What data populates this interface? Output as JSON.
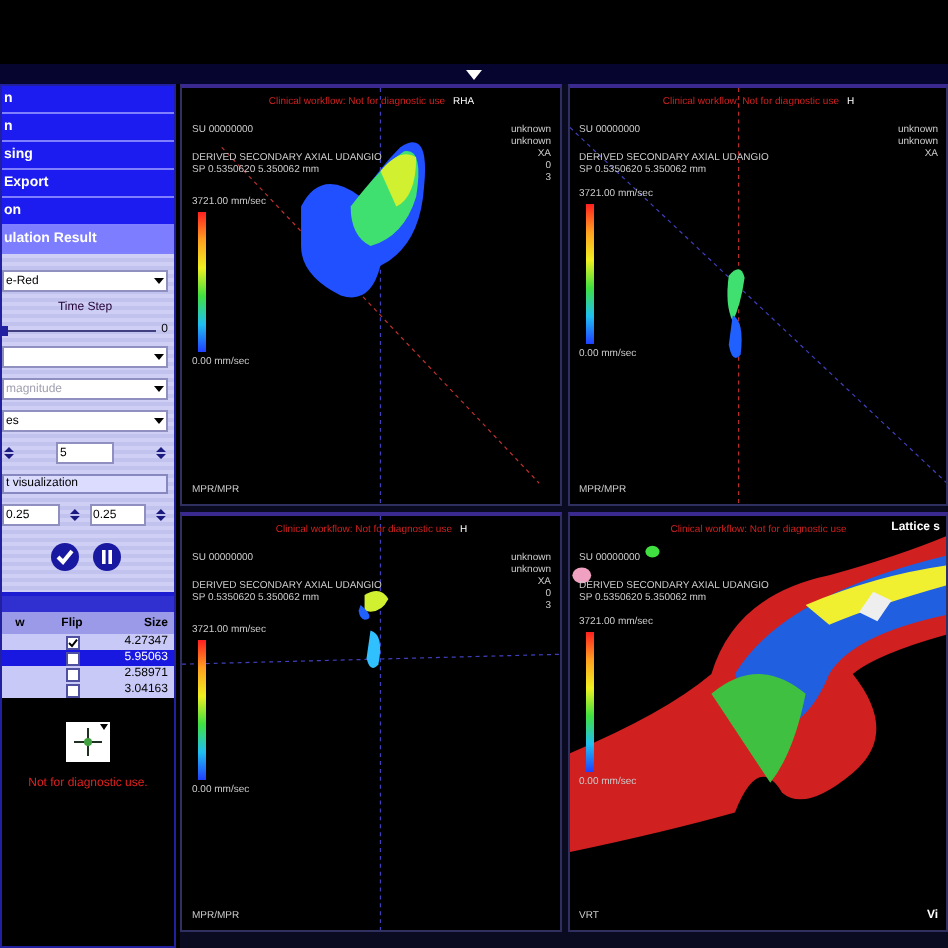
{
  "sidebar": {
    "menu": [
      {
        "label": "n",
        "selected": false
      },
      {
        "label": "n",
        "selected": false
      },
      {
        "label": "sing",
        "selected": false
      },
      {
        "label": "Export",
        "selected": false
      },
      {
        "label": "on",
        "selected": false
      },
      {
        "label": "ulation Result",
        "selected": true
      }
    ],
    "controls": [
      {
        "kind": "dropdown",
        "value": "e-Red"
      },
      {
        "kind": "label",
        "text": "Time Step"
      },
      {
        "kind": "slider",
        "level": 0,
        "reading": "0"
      },
      {
        "kind": "dropdown"
      },
      {
        "kind": "dropdown",
        "value": "magnitude",
        "disabled": true
      },
      {
        "kind": "dropdown",
        "value": "es"
      },
      {
        "kind": "spinners",
        "values": [
          "5"
        ]
      },
      {
        "kind": "button",
        "label": "t visualization"
      },
      {
        "kind": "spinners",
        "values": [
          "0.25",
          "0.25"
        ]
      }
    ],
    "table": {
      "columns": [
        "w",
        "Flip",
        "Size"
      ],
      "rows": [
        {
          "flip": true,
          "size": "4.27347",
          "selected": false
        },
        {
          "flip": false,
          "size": "5.95063",
          "selected": true
        },
        {
          "flip": false,
          "size": "2.58971",
          "selected": false
        },
        {
          "flip": false,
          "size": "3.04163",
          "selected": false
        }
      ]
    },
    "warning": "Not for diagnostic use."
  },
  "viewports": [
    {
      "kind": "mpr",
      "banner": "Clinical workflow: Not for diagnostic use",
      "orientation": "RHA",
      "series": "SU 00000000",
      "description": "DERIVED SECONDARY AXIAL UDANGIO",
      "spacing": "SP 0.5350620 5.350062 mm",
      "info": [
        "unknown",
        "unknown",
        "XA",
        "0",
        "3"
      ],
      "scale_max": "3721.00 mm/sec",
      "scale_min": "0.00 mm/sec",
      "label": "MPR/MPR"
    },
    {
      "kind": "mpr",
      "banner": "Clinical workflow: Not for diagnostic use",
      "orientation": "H",
      "series": "SU 00000000",
      "description": "DERIVED SECONDARY AXIAL UDANGIO",
      "spacing": "SP 0.5350620 5.350062 mm",
      "info": [
        "unknown",
        "unknown",
        "XA"
      ],
      "scale_max": "3721.00 mm/sec",
      "scale_min": "0.00 mm/sec",
      "label": "MPR/MPR"
    },
    {
      "kind": "mpr",
      "banner": "Clinical workflow: Not for diagnostic use",
      "orientation": "H",
      "series": "SU 00000000",
      "description": "DERIVED SECONDARY AXIAL UDANGIO",
      "spacing": "SP 0.5350620 5.350062 mm",
      "info": [
        "unknown",
        "unknown",
        "XA",
        "0",
        "3"
      ],
      "scale_max": "3721.00 mm/sec",
      "scale_min": "0.00 mm/sec",
      "label": "MPR/MPR"
    },
    {
      "kind": "vrt",
      "banner": "Clinical workflow: Not for diagnostic use",
      "title": "Lattice s",
      "series": "SU 00000000",
      "description": "DERIVED SECONDARY AXIAL UDANGIO",
      "spacing": "SP 0.5350620 5.350062 mm",
      "scale_max": "3721.00 mm/sec",
      "scale_min": "0.00 mm/sec",
      "label": "VRT",
      "footer": "Vi"
    }
  ]
}
